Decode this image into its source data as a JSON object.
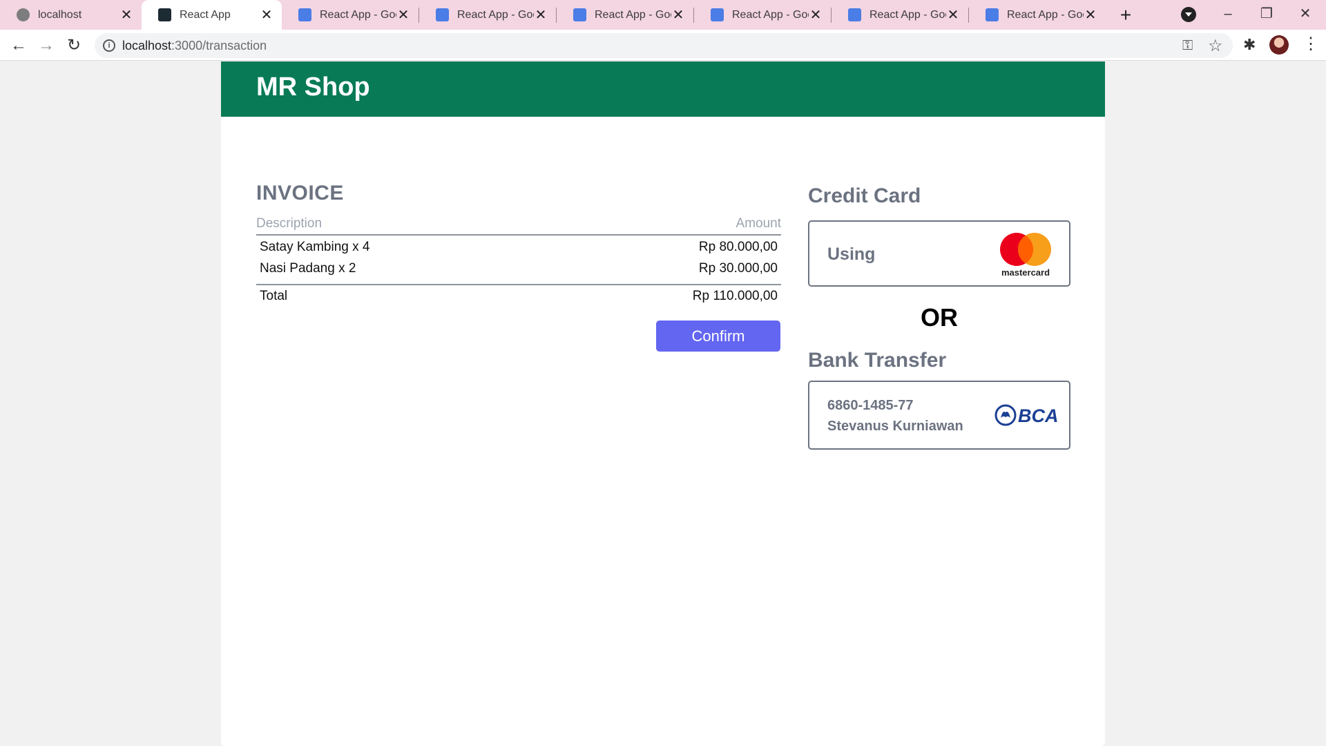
{
  "browser": {
    "tabs": [
      {
        "title": "localhost",
        "icon": "globe-icon",
        "active": false
      },
      {
        "title": "React App",
        "icon": "react-icon",
        "active": true
      },
      {
        "title": "React App - Goog",
        "icon": "google-docs-icon",
        "active": false
      },
      {
        "title": "React App - Goog",
        "icon": "google-docs-icon",
        "active": false
      },
      {
        "title": "React App - Goog",
        "icon": "google-docs-icon",
        "active": false
      },
      {
        "title": "React App - Goog",
        "icon": "google-docs-icon",
        "active": false
      },
      {
        "title": "React App - Goog",
        "icon": "google-docs-icon",
        "active": false
      },
      {
        "title": "React App - Goog",
        "icon": "google-docs-icon",
        "active": false
      }
    ],
    "close_glyph": "✕",
    "new_tab_glyph": "+",
    "url_host": "localhost",
    "url_path": ":3000/transaction"
  },
  "shop": {
    "brand": "MR Shop",
    "brand_color": "#087a56"
  },
  "invoice": {
    "title": "INVOICE",
    "col_description": "Description",
    "col_amount": "Amount",
    "items": [
      {
        "description": "Satay Kambing x 4",
        "amount": "Rp 80.000,00"
      },
      {
        "description": "Nasi Padang x 2",
        "amount": "Rp 30.000,00"
      }
    ],
    "total_label": "Total",
    "total_amount": "Rp 110.000,00",
    "confirm_label": "Confirm",
    "confirm_color": "#6366f1"
  },
  "payment": {
    "credit_card_title": "Credit Card",
    "credit_card_using": "Using",
    "credit_card_brand": "mastercard",
    "or_label": "OR",
    "bank_transfer_title": "Bank Transfer",
    "bank_account": "6860-1485-77",
    "bank_account_name": "Stevanus Kurniawan",
    "bank_brand": "BCA"
  }
}
